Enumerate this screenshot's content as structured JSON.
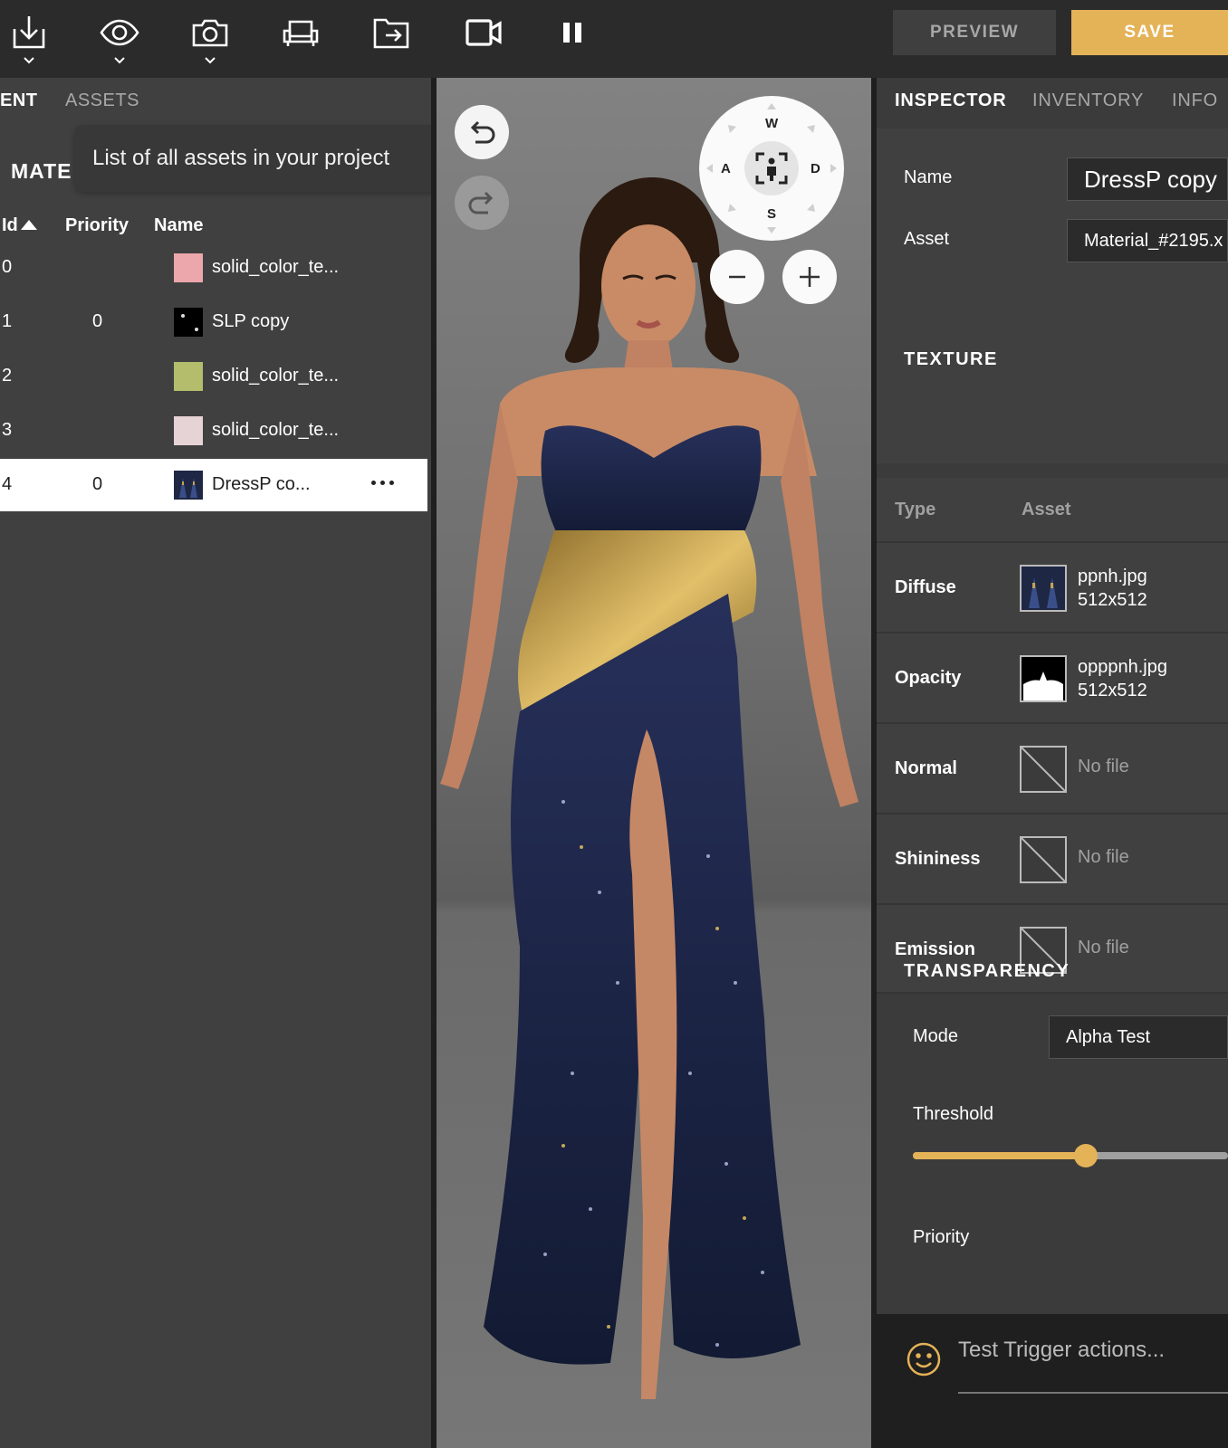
{
  "toolbar": {
    "preview_label": "PREVIEW",
    "save_label": "SAVE",
    "icons": [
      "import-icon",
      "eye-icon",
      "camera-icon",
      "furniture-icon",
      "export-folder-icon",
      "video-camera-icon",
      "pause-icon"
    ]
  },
  "left_panel": {
    "tabs": {
      "active": "ENT",
      "assets": "ASSETS"
    },
    "section_title": "MATE",
    "tooltip": "List of all assets in your project",
    "columns": {
      "id": "Id",
      "priority": "Priority",
      "name": "Name"
    },
    "rows": [
      {
        "id": "0",
        "priority": "",
        "name": "solid_color_te...",
        "swatch": "#eba7ab"
      },
      {
        "id": "1",
        "priority": "0",
        "name": "SLP copy",
        "swatch": "#000000"
      },
      {
        "id": "2",
        "priority": "",
        "name": "solid_color_te...",
        "swatch": "#b3bd6c"
      },
      {
        "id": "3",
        "priority": "",
        "name": "solid_color_te...",
        "swatch": "#e6d3d6"
      },
      {
        "id": "4",
        "priority": "0",
        "name": "DressP co...",
        "swatch": "#1e2744"
      }
    ]
  },
  "viewport": {
    "compass": {
      "n": "W",
      "w": "A",
      "e": "D",
      "s": "S"
    }
  },
  "inspector": {
    "tabs": {
      "inspector": "INSPECTOR",
      "inventory": "INVENTORY",
      "info": "INFO"
    },
    "name_label": "Name",
    "name_value": "DressP copy",
    "asset_label": "Asset",
    "asset_value": "Material_#2195.x",
    "texture_title": "TEXTURE",
    "texture_head": {
      "type": "Type",
      "asset": "Asset"
    },
    "textures": [
      {
        "type": "Diffuse",
        "file": "ppnh.jpg",
        "size": "512x512"
      },
      {
        "type": "Opacity",
        "file": "opppnh.jpg",
        "size": "512x512"
      },
      {
        "type": "Normal",
        "nofile": "No file"
      },
      {
        "type": "Shininess",
        "nofile": "No file"
      },
      {
        "type": "Emission",
        "nofile": "No file"
      }
    ],
    "transparency_title": "TRANSPARENCY",
    "mode_label": "Mode",
    "mode_value": "Alpha Test",
    "threshold_label": "Threshold",
    "threshold_fraction": 0.55,
    "priority_label": "Priority",
    "trigger_placeholder": "Test Trigger actions..."
  },
  "colors": {
    "accent": "#e4b257",
    "panel": "#404040",
    "toolbar": "#2b2b2b"
  }
}
